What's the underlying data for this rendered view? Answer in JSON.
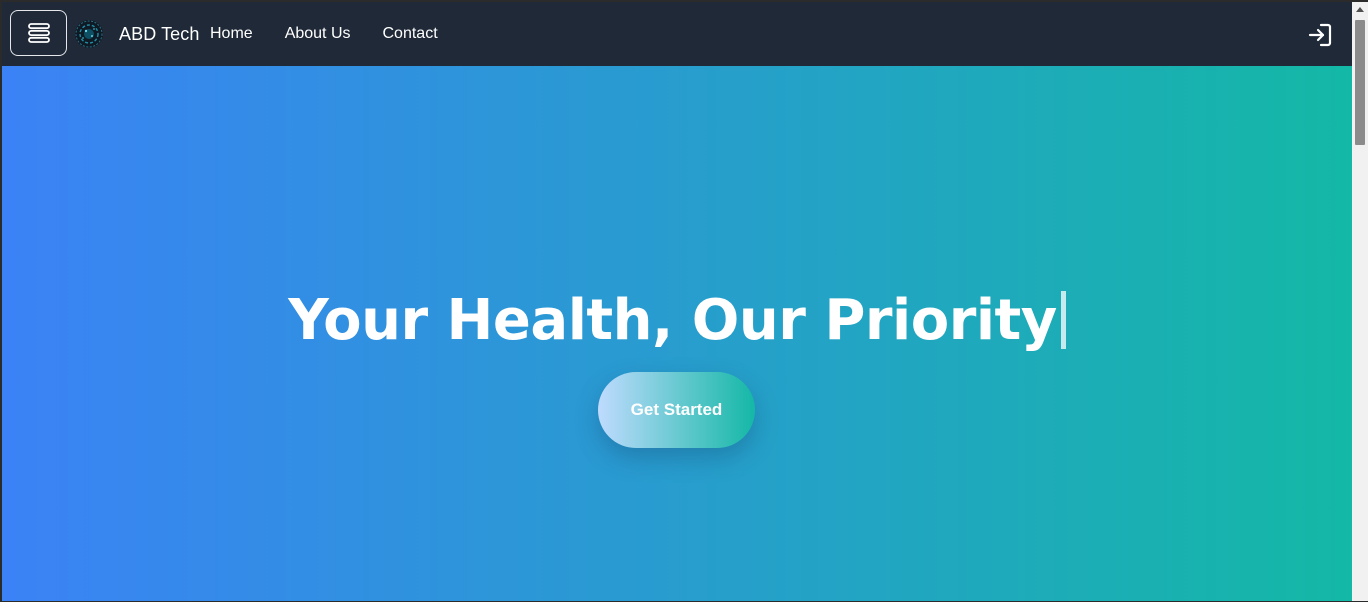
{
  "navbar": {
    "brand": "ABD Tech",
    "links": [
      "Home",
      "About Us",
      "Contact"
    ],
    "menu_icon": "menu-icon",
    "logo_icon": "logo-icon",
    "login_icon": "login-icon"
  },
  "hero": {
    "title": "Your Health, Our Priority",
    "cta_label": "Get Started"
  },
  "colors": {
    "navbar_bg": "#1f2937",
    "gradient_start": "#3b82f6",
    "gradient_end": "#14b8a6",
    "text": "#ffffff"
  }
}
